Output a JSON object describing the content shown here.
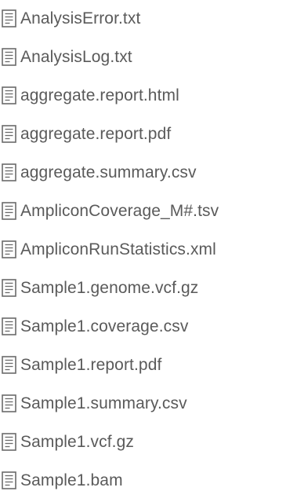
{
  "files": [
    {
      "name": "AnalysisError.txt",
      "icon": "text-file-icon"
    },
    {
      "name": "AnalysisLog.txt",
      "icon": "text-file-icon"
    },
    {
      "name": "aggregate.report.html",
      "icon": "text-file-icon"
    },
    {
      "name": "aggregate.report.pdf",
      "icon": "text-file-icon"
    },
    {
      "name": "aggregate.summary.csv",
      "icon": "text-file-icon"
    },
    {
      "name": "AmpliconCoverage_M#.tsv",
      "icon": "text-file-icon"
    },
    {
      "name": "AmpliconRunStatistics.xml",
      "icon": "text-file-icon"
    },
    {
      "name": "Sample1.genome.vcf.gz",
      "icon": "text-file-icon"
    },
    {
      "name": "Sample1.coverage.csv",
      "icon": "text-file-icon"
    },
    {
      "name": "Sample1.report.pdf",
      "icon": "text-file-icon"
    },
    {
      "name": "Sample1.summary.csv",
      "icon": "text-file-icon"
    },
    {
      "name": "Sample1.vcf.gz",
      "icon": "text-file-icon"
    },
    {
      "name": "Sample1.bam",
      "icon": "text-file-icon"
    }
  ],
  "colors": {
    "text": "#5a5a5a",
    "icon_stroke": "#6b6b6b",
    "background": "#ffffff"
  }
}
